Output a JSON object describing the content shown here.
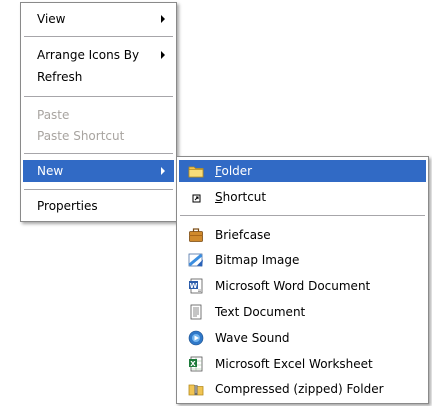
{
  "main_menu": {
    "items": [
      {
        "label": "View"
      },
      {
        "label": "Arrange Icons By"
      },
      {
        "label": "Refresh"
      },
      {
        "label": "Paste"
      },
      {
        "label": "Paste Shortcut"
      },
      {
        "label": "New"
      },
      {
        "label": "Properties"
      }
    ]
  },
  "new_submenu": {
    "folder": {
      "first": "F",
      "rest": "older",
      "icon": "folder-icon"
    },
    "shortcut": {
      "first": "S",
      "rest": "hortcut",
      "icon": "shortcut-icon"
    },
    "items": [
      {
        "label": "Briefcase",
        "icon": "briefcase-icon"
      },
      {
        "label": "Bitmap Image",
        "icon": "bitmap-icon"
      },
      {
        "label": "Microsoft Word Document",
        "icon": "word-icon"
      },
      {
        "label": "Text Document",
        "icon": "text-document-icon"
      },
      {
        "label": "Wave Sound",
        "icon": "wave-sound-icon"
      },
      {
        "label": "Microsoft Excel Worksheet",
        "icon": "excel-icon"
      },
      {
        "label": "Compressed (zipped) Folder",
        "icon": "zip-folder-icon"
      }
    ]
  },
  "colors": {
    "highlight": "#316ac5",
    "disabled_text": "#a8a4a0",
    "border": "#8a8a8a"
  }
}
